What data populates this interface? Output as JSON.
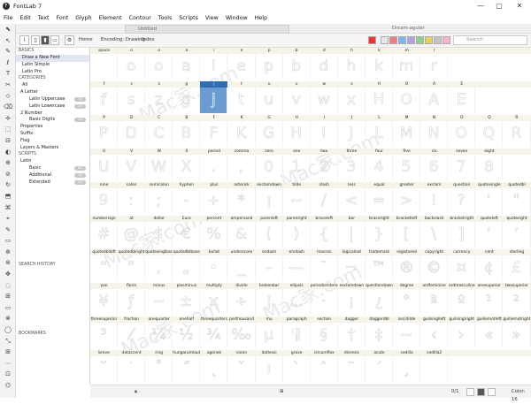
{
  "window": {
    "title": "FontLab 7",
    "app_icon_glyph": "F",
    "buttons": [
      "—",
      "▢",
      "✕"
    ]
  },
  "menu": [
    "File",
    "Edit",
    "Text",
    "Font",
    "Glyph",
    "Element",
    "Contour",
    "Tools",
    "Scripts",
    "View",
    "Window",
    "Help"
  ],
  "tabs": {
    "active": "Untitled",
    "secondary": "Dream-agular"
  },
  "toolbar": {
    "info_btn": "i",
    "home_label": "Home",
    "encoding_label": "Encoding: Drawing",
    "index_label": "Index",
    "search_placeholder": "Search",
    "swatch_colors": [
      "#e8e8e8",
      "#f08080",
      "#7db7f0",
      "#b7a0e8",
      "#8fd18f",
      "#e6d05c",
      "#c4c4c4",
      "#ffb0d0"
    ]
  },
  "left_tools": [
    "⬉",
    "↖",
    "✎",
    "ℓ",
    "T",
    "✂",
    "⟐",
    "⌫",
    "✛",
    "⬚",
    "⊟",
    "◐",
    "⊕",
    "⊘",
    "↻",
    "⬒",
    "⌘",
    "⌖",
    "✎",
    "▭",
    "⊕",
    "⊛",
    "✥",
    "◌",
    "⊞",
    "▭",
    "⊗",
    "◯",
    "⤡",
    "⊞",
    "⋯",
    "⊡",
    "⌬"
  ],
  "sidebar": {
    "sections": [
      {
        "head": "BASICS",
        "items": [
          {
            "label": "Draw a New Font",
            "selected": true,
            "indent": 5
          },
          {
            "label": "Latin Simple",
            "indent": 5
          },
          {
            "label": "Latin Pro",
            "indent": 5
          }
        ]
      },
      {
        "head": "CATEGORIES",
        "items": [
          {
            "label": "All",
            "indent": 5
          },
          {
            "label": "A  Letter",
            "indent": 3
          },
          {
            "label": "Latin Uppercase",
            "indent": 13,
            "count": "26"
          },
          {
            "label": "Latin Lowercase",
            "indent": 13,
            "count": "26"
          },
          {
            "label": "2  Number",
            "indent": 3
          },
          {
            "label": "Basic Digits",
            "indent": 13,
            "count": "10"
          },
          {
            "label": "Properties",
            "indent": 3
          },
          {
            "label": "Suffix",
            "indent": 3
          },
          {
            "label": "Flag",
            "indent": 3
          },
          {
            "label": "Layers & Masters",
            "indent": 3
          }
        ]
      },
      {
        "head": "SCRIPTS",
        "items": [
          {
            "label": "Latin",
            "indent": 3
          },
          {
            "label": "Basic",
            "indent": 13,
            "count": "62"
          },
          {
            "label": "Additional",
            "indent": 13,
            "count": "16"
          },
          {
            "label": "Extended",
            "indent": 13,
            "count": "43"
          }
        ]
      },
      {
        "head": "SEARCH HISTORY",
        "items": []
      },
      {
        "head": "BOOKMARKS",
        "items": []
      }
    ]
  },
  "glyph_grid": [
    {
      "labels": [
        "space",
        "o",
        "o",
        "a",
        "i",
        "e",
        "p",
        "b",
        "d",
        "h",
        "k",
        "m",
        "r"
      ],
      "glyphs": [
        "",
        "o",
        "o",
        "a",
        "i",
        "e",
        "p",
        "b",
        "d",
        "h",
        "k",
        "m",
        "r"
      ]
    },
    {
      "labels": [
        "f",
        "s",
        "z",
        "g",
        "j",
        "t",
        "u",
        "v",
        "w",
        "x",
        "H",
        "O",
        "A",
        "E"
      ],
      "glyphs": [
        "f",
        "s",
        "z",
        "g",
        "j",
        "t",
        "u",
        "v",
        "w",
        "x",
        "H",
        "O",
        "A",
        "E"
      ],
      "highlight": 4
    },
    {
      "labels": [
        "P",
        "D",
        "C",
        "B",
        "F",
        "K",
        "G",
        "H",
        "I",
        "J",
        "L",
        "M",
        "N",
        "O",
        "Q",
        "R"
      ],
      "glyphs": [
        "P",
        "D",
        "C",
        "B",
        "F",
        "K",
        "G",
        "H",
        "I",
        "J",
        "L",
        "M",
        "N",
        "O",
        "Q",
        "R"
      ]
    },
    {
      "labels": [
        "U",
        "V",
        "W",
        "X",
        "period",
        "comma",
        "zero",
        "one",
        "two",
        "three",
        "four",
        "five",
        "six",
        "seven",
        "eight"
      ],
      "glyphs": [
        "U",
        "V",
        "W",
        "X",
        ".",
        ",",
        "0",
        "1",
        "2",
        "3",
        "4",
        "5",
        "6",
        "7",
        "8"
      ]
    },
    {
      "labels": [
        "nine",
        "colon",
        "semicolon",
        "hyphen",
        "plus",
        "asterisk",
        "exclamdown",
        "tilde",
        "slash",
        "less",
        "equal",
        "greater",
        "exclam",
        "question",
        "quotesingle",
        "quotedbl"
      ],
      "glyphs": [
        "9",
        ":",
        ";",
        "-",
        "+",
        "*",
        "¡",
        "~",
        "/",
        "<",
        "=",
        ">",
        "!",
        "?",
        "'",
        "\""
      ]
    },
    {
      "labels": [
        "numbersign",
        "at",
        "dollar",
        "Euro",
        "percent",
        "ampersand",
        "parenleft",
        "parenright",
        "braceleft",
        "bar",
        "braceright",
        "bracketleft",
        "backslash",
        "bracketright",
        "quoteleft",
        "quoteright"
      ],
      "glyphs": [
        "#",
        "@",
        "$",
        "€",
        "%",
        "&",
        "(",
        ")",
        "{",
        "|",
        "}",
        "[",
        "\\",
        "]",
        "‘",
        "’"
      ]
    },
    {
      "labels": [
        "quotedblleft",
        "quotedblright",
        "quotesinglbase",
        "quotedblbase",
        "bullet",
        "underscore",
        "endash",
        "emdash",
        "macron",
        "logicalnot",
        "trademark",
        "registered",
        "copyright",
        "currency",
        "cent",
        "sterling"
      ],
      "glyphs": [
        "“",
        "”",
        "‚",
        "„",
        "•",
        "_",
        "–",
        "—",
        "¯",
        "¬",
        "™",
        "®",
        "©",
        "¤",
        "¢",
        "£"
      ]
    },
    {
      "labels": [
        "yen",
        "florin",
        "minus",
        "plusminus",
        "multiply",
        "divide",
        "brokenbar",
        "ellipsis",
        "periodcentered",
        "exclamdown",
        "questiondown",
        "degree",
        "ordfeminine",
        "ordmasculine",
        "onesuperior",
        "twosuperior"
      ],
      "glyphs": [
        "¥",
        "ƒ",
        "−",
        "±",
        "×",
        "÷",
        "¦",
        "…",
        "·",
        "¡",
        "¿",
        "°",
        "ª",
        "º",
        "¹",
        "²"
      ]
    },
    {
      "labels": [
        "threesuperior",
        "fraction",
        "onequarter",
        "onehalf",
        "threequarters",
        "perthousand",
        "mu",
        "paragraph",
        "section",
        "dagger",
        "daggerdbl",
        "asciitilde",
        "guilsinglleft",
        "guilsinglright",
        "guillemotleft",
        "guillemotright"
      ],
      "glyphs": [
        "³",
        "⁄",
        "¼",
        "½",
        "¾",
        "‰",
        "μ",
        "¶",
        "§",
        "†",
        "‡",
        "~",
        "‹",
        "›",
        "«",
        "»"
      ]
    },
    {
      "labels": [
        "breve",
        "dotaccent",
        "ring",
        "hungarumlaut",
        "ogonek",
        "caron",
        "dotlessi",
        "grave",
        "circumflex",
        "dieresis",
        "acute",
        "cedilla",
        "cedilla2"
      ],
      "glyphs": [
        "˘",
        "˙",
        "˚",
        "˝",
        "˛",
        "ˇ",
        "ı",
        "`",
        "ˆ",
        "¨",
        "´",
        "¸",
        ""
      ]
    }
  ],
  "statusbar": {
    "zoom": "0/1",
    "color_label": "Color: 16"
  },
  "watermarks": [
    "Mac家.com",
    "Mac家.com",
    "Mac家.com",
    "Mac家.com",
    "Mac家.com"
  ]
}
